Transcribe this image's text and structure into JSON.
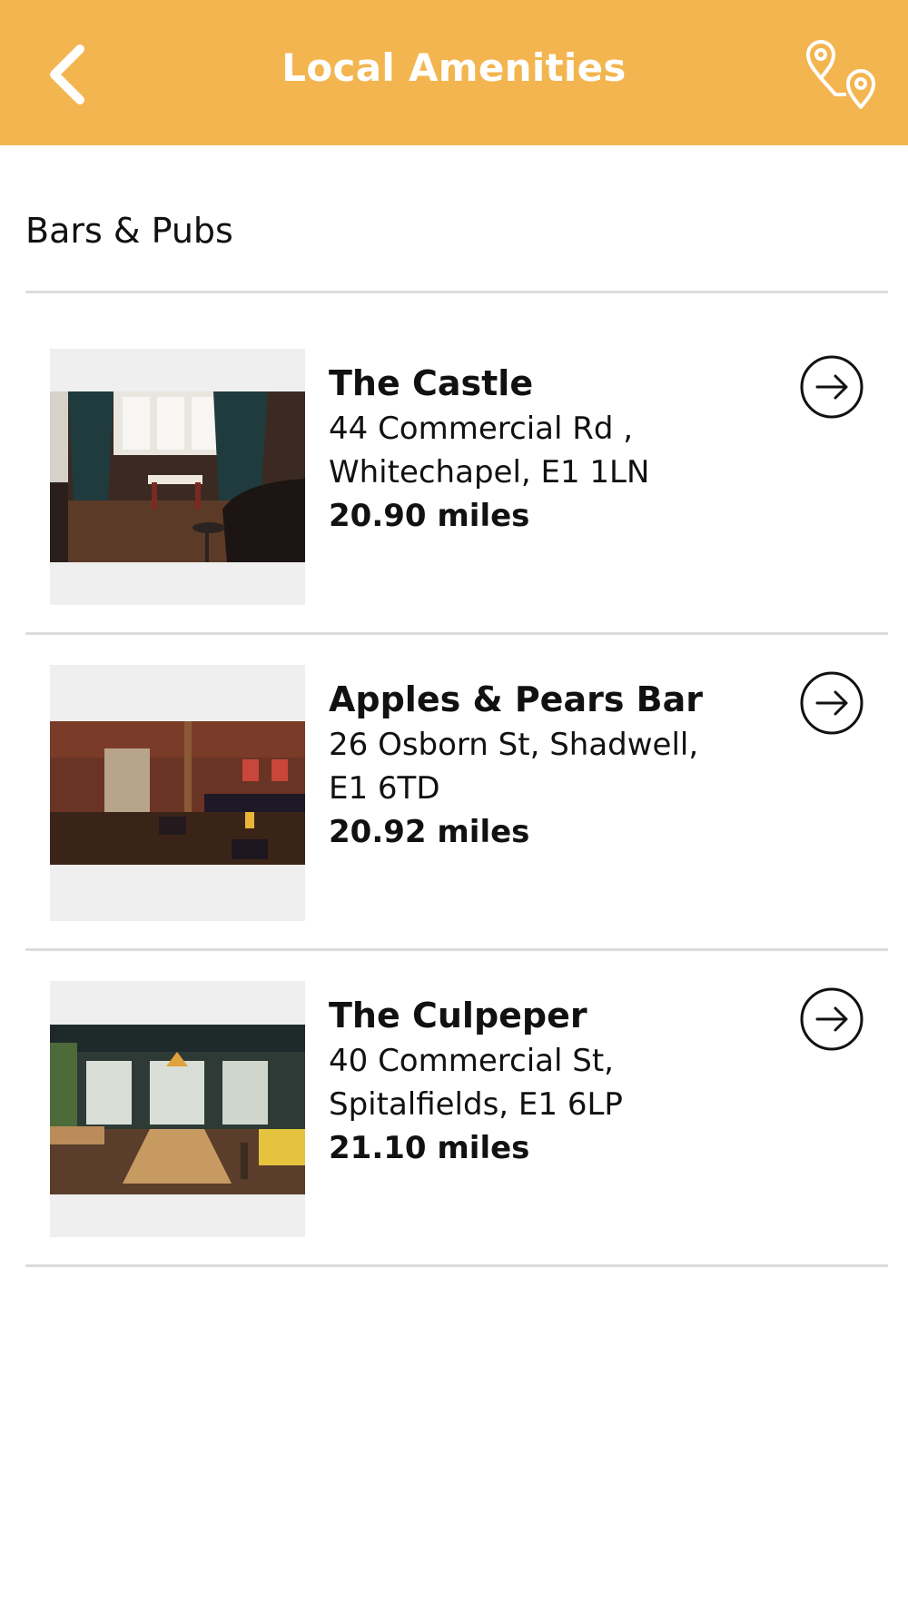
{
  "header": {
    "title": "Local Amenities",
    "background_color": "#f3b54f",
    "back_icon": "chevron-left-icon",
    "map_icon": "map-route-pins-icon"
  },
  "section": {
    "title": "Bars & Pubs"
  },
  "items": [
    {
      "name": "The Castle",
      "address": "44 Commercial Rd , Whitechapel, E1 1LN",
      "distance": "20.90 miles",
      "photo": "pub-interior-photo",
      "action_icon": "arrow-right-circle-icon"
    },
    {
      "name": "Apples & Pears Bar",
      "address": "26 Osborn St, Shadwell, E1 6TD",
      "distance": "20.92 miles",
      "photo": "bar-interior-photo",
      "action_icon": "arrow-right-circle-icon"
    },
    {
      "name": "The Culpeper",
      "address": "40 Commercial St, Spitalfields, E1 6LP",
      "distance": "21.10 miles",
      "photo": "pub-interior-photo",
      "action_icon": "arrow-right-circle-icon"
    }
  ]
}
